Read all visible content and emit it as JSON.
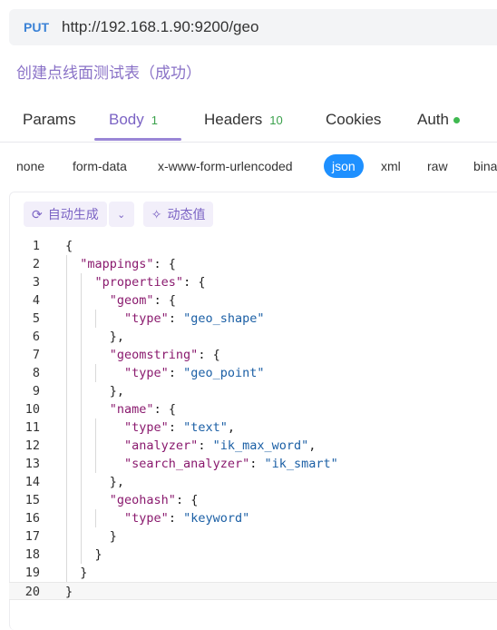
{
  "request": {
    "method": "PUT",
    "url": "http://192.168.1.90:9200/geo",
    "title": "创建点线面测试表（成功）"
  },
  "tabs": [
    {
      "label": "Params",
      "count": ""
    },
    {
      "label": "Body",
      "count": "1"
    },
    {
      "label": "Headers",
      "count": "10"
    },
    {
      "label": "Cookies",
      "count": ""
    },
    {
      "label": "Auth",
      "count": ""
    }
  ],
  "body_types": [
    "none",
    "form-data",
    "x-www-form-urlencoded",
    "json",
    "xml",
    "raw",
    "bina"
  ],
  "toolbar": {
    "auto_generate": "自动生成",
    "dynamic_value": "动态值"
  },
  "code_lines": [
    "{",
    "  \"mappings\": {",
    "    \"properties\": {",
    "      \"geom\": {",
    "        \"type\": \"geo_shape\"",
    "      },",
    "      \"geomstring\": {",
    "        \"type\": \"geo_point\"",
    "      },",
    "      \"name\": {",
    "        \"type\": \"text\",",
    "        \"analyzer\": \"ik_max_word\",",
    "        \"search_analyzer\": \"ik_smart\"",
    "      },",
    "      \"geohash\": {",
    "        \"type\": \"keyword\"",
    "      }",
    "    }",
    "  }",
    "}"
  ],
  "colors": {
    "accent": "#7b63c4",
    "method": "#3b82d6",
    "json_active": "#1e90ff",
    "count": "#3aa14b",
    "key": "#8a1a6e",
    "string": "#1b5fa5"
  }
}
